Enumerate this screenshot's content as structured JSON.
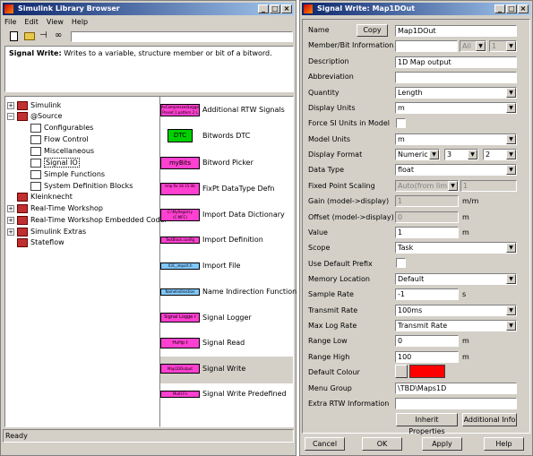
{
  "browser": {
    "title": "Simulink Library Browser",
    "menu": [
      "File",
      "Edit",
      "View",
      "Help"
    ],
    "description_bold": "Signal Write:",
    "description_text": " Writes to a variable, structure member or bit of a bitword.",
    "status": "Ready",
    "tree": [
      {
        "label": "Simulink",
        "expander": "+",
        "level": 0
      },
      {
        "label": "@Source",
        "expander": "−",
        "level": 0
      },
      {
        "label": "Configurables",
        "level": 1
      },
      {
        "label": "Flow Control",
        "level": 1
      },
      {
        "label": "Miscellaneous",
        "level": 1
      },
      {
        "label": "Signal IO",
        "level": 1,
        "selected": true
      },
      {
        "label": "Simple Functions",
        "level": 1
      },
      {
        "label": "System Definition Blocks",
        "level": 1
      },
      {
        "label": "Kleinknecht",
        "level": 0
      },
      {
        "label": "Real-Time Workshop",
        "expander": "+",
        "level": 0
      },
      {
        "label": "Real-Time Workshop Embedded Coder",
        "expander": "+",
        "level": 0
      },
      {
        "label": "Simulink Extras",
        "expander": "+",
        "level": 0
      },
      {
        "label": "Stateflow",
        "level": 0
      }
    ],
    "blocks": [
      {
        "label": "Additional RTW Signals",
        "glyph": "AsCompressedLogged Preset 1 pattern 2 L"
      },
      {
        "label": "Bitwords DTC",
        "glyph": "DTC"
      },
      {
        "label": "Bitword Picker",
        "glyph": "myBits"
      },
      {
        "label": "FixPt DataType Defn",
        "glyph": "tmp fix 16 15 0b"
      },
      {
        "label": "Import Data Dictionary",
        "glyph": "C:\\MyRegistry (C:MFC)"
      },
      {
        "label": "Import Definition",
        "glyph": "TestBlock.config"
      },
      {
        "label": "Import File",
        "glyph": "X3C_import.h"
      },
      {
        "label": "Name Indirection Function",
        "glyph": "NameIndirection"
      },
      {
        "label": "Signal Logger",
        "glyph": "Signal Logge r"
      },
      {
        "label": "Signal Read",
        "glyph": "HvHp t"
      },
      {
        "label": "Signal Write",
        "glyph": "Map1DOutput",
        "selected": true
      },
      {
        "label": "Signal Write Predefined",
        "glyph": "Multi-Fn"
      }
    ]
  },
  "dialog": {
    "title": "Signal Write: Map1DOut",
    "name_label": "Name",
    "copy_button": "Copy",
    "name_value": "Map1DOut",
    "member_label": "Member/Bit Information",
    "member_all": "All",
    "member_one": "1",
    "description_label": "Description",
    "description_value": "1D Map output",
    "abbreviation_label": "Abbreviation",
    "quantity_label": "Quantity",
    "quantity_value": "Length",
    "display_units_label": "Display Units",
    "display_units_value": "m",
    "force_si_label": "Force SI Units in Model",
    "model_units_label": "Model Units",
    "model_units_value": "m",
    "display_format_label": "Display Format",
    "display_format_value": "Numeric",
    "display_format_a": "3",
    "display_format_b": "2",
    "data_type_label": "Data Type",
    "data_type_value": "float",
    "fixed_point_label": "Fixed Point Scaling",
    "fixed_point_value": "Auto(from limi...",
    "fixed_point_num": "1",
    "gain_label": "Gain (model->display)",
    "gain_value": "1",
    "gain_unit": "m/m",
    "offset_label": "Offset (model->display)",
    "offset_value": "0",
    "offset_unit": "m",
    "value_label": "Value",
    "value_value": "1",
    "value_unit": "m",
    "scope_label": "Scope",
    "scope_value": "Task",
    "default_prefix_label": "Use Default Prefix",
    "memory_label": "Memory Location",
    "memory_value": "Default",
    "sample_rate_label": "Sample Rate",
    "sample_rate_value": "-1",
    "sample_rate_unit": "s",
    "transmit_label": "Transmit Rate",
    "transmit_value": "100ms",
    "maxlog_label": "Max Log Rate",
    "maxlog_value": "Transmit Rate",
    "range_low_label": "Range Low",
    "range_low_value": "0",
    "range_low_unit": "m",
    "range_high_label": "Range High",
    "range_high_value": "100",
    "range_high_unit": "m",
    "default_colour_label": "Default Colour",
    "default_colour_hex": "#ff0000",
    "menu_group_label": "Menu Group",
    "menu_group_value": "\\TBD\\Maps1D",
    "extra_rtw_label": "Extra RTW Information",
    "inherit_button": "Inherit Properties",
    "additional_button": "Additional Info",
    "cancel_button": "Cancel",
    "ok_button": "OK",
    "apply_button": "Apply",
    "help_button": "Help"
  }
}
